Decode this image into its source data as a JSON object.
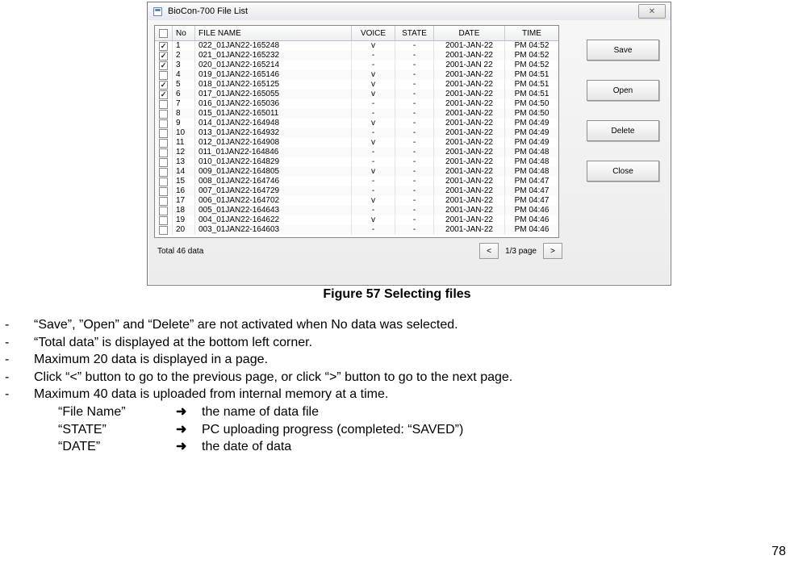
{
  "dialog": {
    "title": "BioCon-700 File List",
    "close_label": "✕",
    "columns": {
      "chk": "",
      "no": "No",
      "filename": "FILE NAME",
      "voice": "VOICE",
      "state": "STATE",
      "date": "DATE",
      "time": "TIME"
    },
    "rows": [
      {
        "chk": true,
        "no": "1",
        "fn": "022_01JAN22-165248",
        "vo": "v",
        "st": "-",
        "dt": "2001-JAN-22",
        "tm": "PM 04:52"
      },
      {
        "chk": true,
        "no": "2",
        "fn": "021_01JAN22-165232",
        "vo": "-",
        "st": "-",
        "dt": "2001-JAN-22",
        "tm": "PM 04:52"
      },
      {
        "chk": true,
        "no": "3",
        "fn": "020_01JAN22-165214",
        "vo": "-",
        "st": "-",
        "dt": "2001-JAN 22",
        "tm": "PM 04:52"
      },
      {
        "chk": false,
        "no": "4",
        "fn": "019_01JAN22-165146",
        "vo": "v",
        "st": "-",
        "dt": "2001-JAN-22",
        "tm": "PM 04:51"
      },
      {
        "chk": true,
        "no": "5",
        "fn": "018_01JAN22-165125",
        "vo": "v",
        "st": "-",
        "dt": "2001-JAN-22",
        "tm": "PM 04:51"
      },
      {
        "chk": true,
        "no": "6",
        "fn": "017_01JAN22-165055",
        "vo": "v",
        "st": "-",
        "dt": "2001-JAN-22",
        "tm": "PM 04:51"
      },
      {
        "chk": false,
        "no": "7",
        "fn": "016_01JAN22-165036",
        "vo": "-",
        "st": "-",
        "dt": "2001-JAN-22",
        "tm": "PM 04:50"
      },
      {
        "chk": false,
        "no": "8",
        "fn": "015_01JAN22-165011",
        "vo": "-",
        "st": "-",
        "dt": "2001-JAN-22",
        "tm": "PM 04:50"
      },
      {
        "chk": false,
        "no": "9",
        "fn": "014_01JAN22-164948",
        "vo": "v",
        "st": "-",
        "dt": "2001-JAN-22",
        "tm": "PM 04:49"
      },
      {
        "chk": false,
        "no": "10",
        "fn": "013_01JAN22-164932",
        "vo": "-",
        "st": "-",
        "dt": "2001-JAN-22",
        "tm": "PM 04:49"
      },
      {
        "chk": false,
        "no": "11",
        "fn": "012_01JAN22-164908",
        "vo": "v",
        "st": "-",
        "dt": "2001-JAN-22",
        "tm": "PM 04:49"
      },
      {
        "chk": false,
        "no": "12",
        "fn": "011_01JAN22-164846",
        "vo": "-",
        "st": "-",
        "dt": "2001-JAN-22",
        "tm": "PM 04:48"
      },
      {
        "chk": false,
        "no": "13",
        "fn": "010_01JAN22-164829",
        "vo": "-",
        "st": "-",
        "dt": "2001-JAN-22",
        "tm": "PM 04:48"
      },
      {
        "chk": false,
        "no": "14",
        "fn": "009_01JAN22-164805",
        "vo": "v",
        "st": "-",
        "dt": "2001-JAN-22",
        "tm": "PM 04:48"
      },
      {
        "chk": false,
        "no": "15",
        "fn": "008_01JAN22-164746",
        "vo": "-",
        "st": "-",
        "dt": "2001-JAN-22",
        "tm": "PM 04:47"
      },
      {
        "chk": false,
        "no": "16",
        "fn": "007_01JAN22-164729",
        "vo": "-",
        "st": "-",
        "dt": "2001-JAN-22",
        "tm": "PM 04:47"
      },
      {
        "chk": false,
        "no": "17",
        "fn": "006_01JAN22-164702",
        "vo": "v",
        "st": "-",
        "dt": "2001-JAN-22",
        "tm": "PM 04:47"
      },
      {
        "chk": false,
        "no": "18",
        "fn": "005_01JAN22-164643",
        "vo": "-",
        "st": "-",
        "dt": "2001-JAN-22",
        "tm": "PM 04:46"
      },
      {
        "chk": false,
        "no": "19",
        "fn": "004_01JAN22-164622",
        "vo": "v",
        "st": "-",
        "dt": "2001-JAN-22",
        "tm": "PM 04:46"
      },
      {
        "chk": false,
        "no": "20",
        "fn": "003_01JAN22-164603",
        "vo": "-",
        "st": "-",
        "dt": "2001-JAN-22",
        "tm": "PM 04:46"
      }
    ],
    "total_text": "Total 46 data",
    "page_text": "1/3 page",
    "prev_label": "<",
    "next_label": ">",
    "side": {
      "save": "Save",
      "open": "Open",
      "delete": "Delete",
      "close": "Close"
    }
  },
  "caption": "Figure 57 Selecting files",
  "notes": [
    "“Save”, ”Open” and “Delete” are not activated when No data was selected.",
    "“Total data” is displayed at the bottom left corner.",
    "Maximum 20 data is displayed in a page.",
    "Click “<” button to go to the previous page, or click “>” button to go to the next page.",
    "Maximum 40 data is uploaded from internal memory at a time."
  ],
  "fields": [
    {
      "name": "“File Name”",
      "desc": "the name of data file"
    },
    {
      "name": "“STATE”",
      "desc": "PC uploading progress (completed: “SAVED”)"
    },
    {
      "name": "“DATE”",
      "desc": "the date of data"
    }
  ],
  "arrow": "➜",
  "dash": "-",
  "page_number": "78"
}
